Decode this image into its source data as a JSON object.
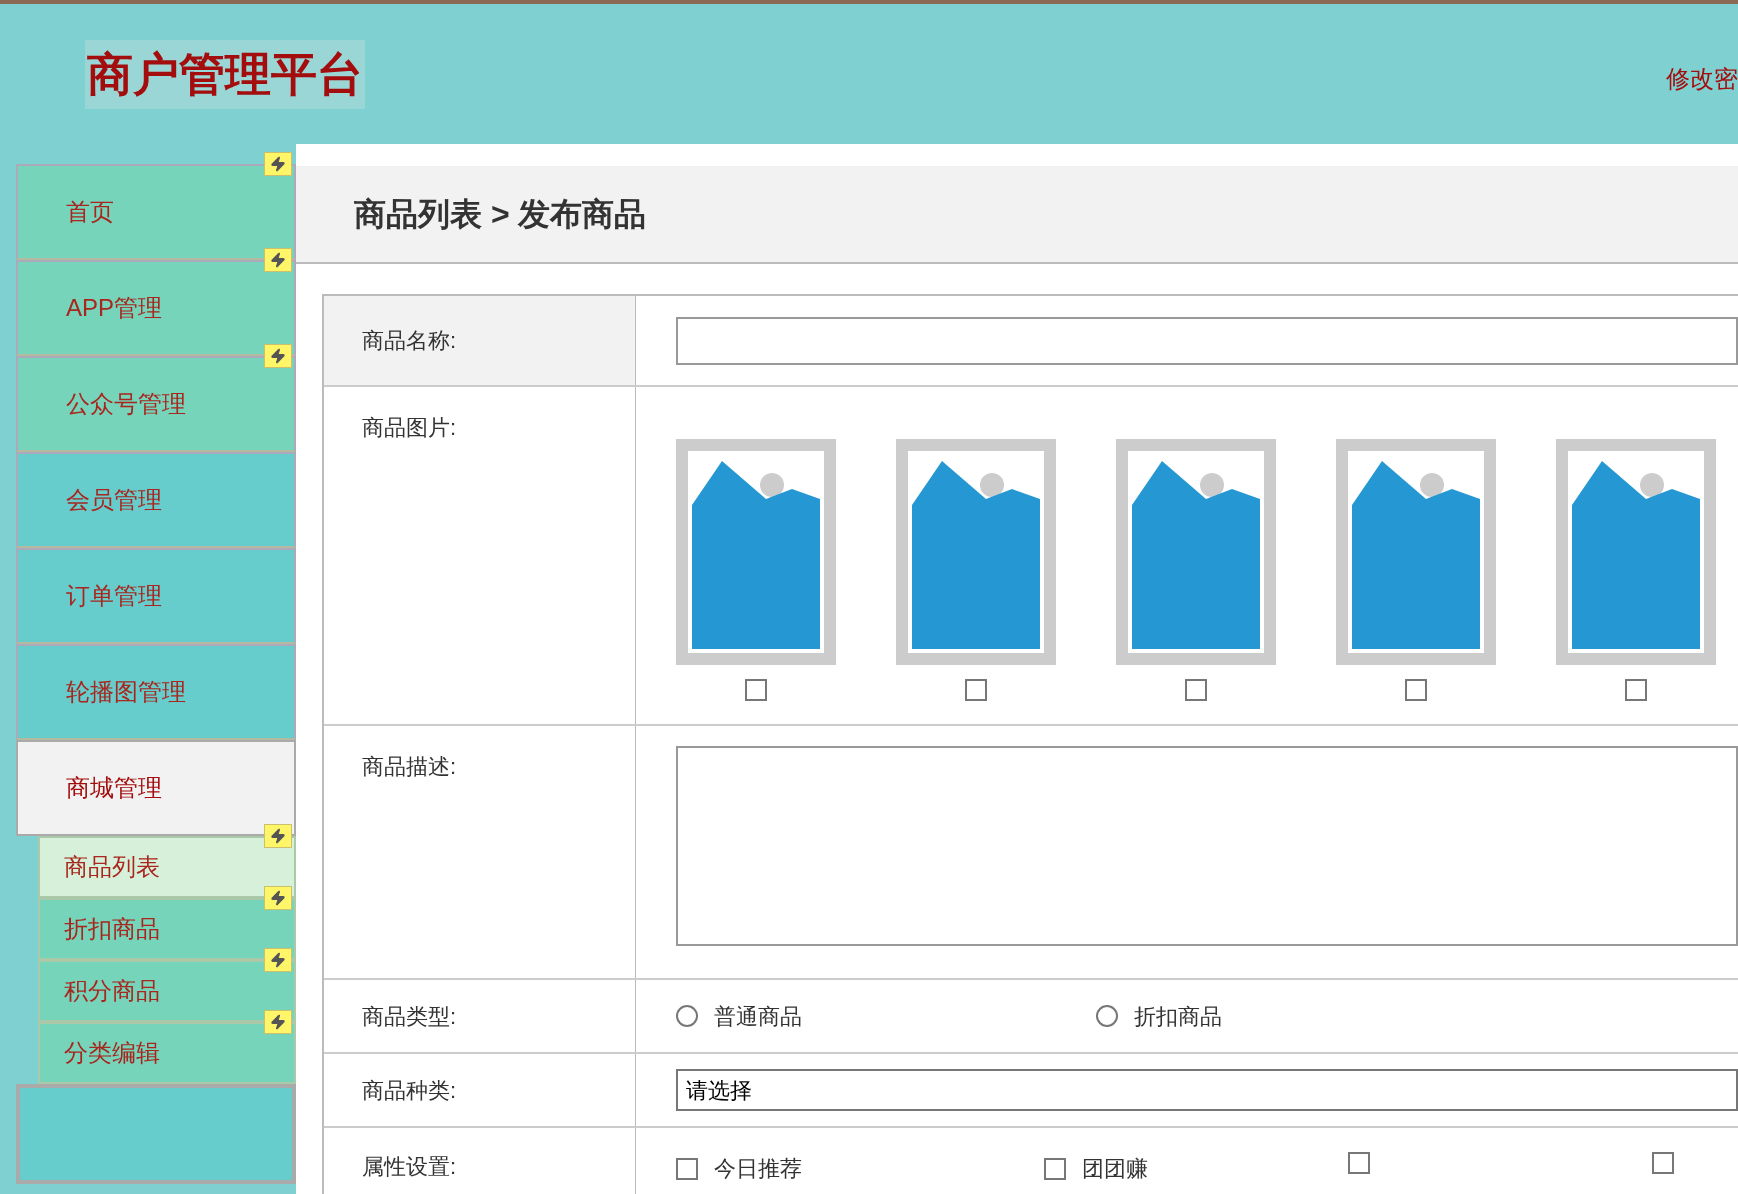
{
  "header": {
    "title": "商户管理平台",
    "link": "修改密"
  },
  "sidebar": {
    "items": [
      {
        "label": "首页",
        "selected": false,
        "color": "#76d4bb",
        "badge": true
      },
      {
        "label": "APP管理",
        "selected": false,
        "color": "#76d4bb",
        "badge": true
      },
      {
        "label": "公众号管理",
        "selected": false,
        "color": "#76d4bb",
        "badge": true
      },
      {
        "label": "会员管理",
        "selected": false,
        "color": "#66cccc",
        "badge": false
      },
      {
        "label": "订单管理",
        "selected": false,
        "color": "#66cccc",
        "badge": false
      },
      {
        "label": "轮播图管理",
        "selected": false,
        "color": "#66cccc",
        "badge": false
      },
      {
        "label": "商城管理",
        "selected": true,
        "color": "#f2f2f2",
        "badge": false,
        "children": [
          {
            "label": "商品列表",
            "selected": true,
            "badge": true
          },
          {
            "label": "折扣商品",
            "selected": false,
            "badge": true
          },
          {
            "label": "积分商品",
            "selected": false,
            "badge": true
          },
          {
            "label": "分类编辑",
            "selected": false,
            "badge": true
          }
        ]
      }
    ]
  },
  "breadcrumb": "商品列表 > 发布商品",
  "form": {
    "name": {
      "label": "商品名称:"
    },
    "images": {
      "label": "商品图片:",
      "items": [
        {
          "checked": false
        },
        {
          "checked": false
        },
        {
          "checked": false
        },
        {
          "checked": false
        },
        {
          "checked": false
        }
      ]
    },
    "description": {
      "label": "商品描述:"
    },
    "type": {
      "label": "商品类型:",
      "options": [
        {
          "label": "普通商品",
          "selected": false
        },
        {
          "label": "折扣商品",
          "selected": false
        }
      ]
    },
    "kind": {
      "label": "商品种类:",
      "value": "请选择"
    },
    "attributes": {
      "label": "属性设置:",
      "options": [
        {
          "label": "今日推荐",
          "checked": false
        },
        {
          "label": "团团赚",
          "checked": false
        },
        {
          "checked": false
        },
        {
          "checked": false
        }
      ]
    }
  }
}
